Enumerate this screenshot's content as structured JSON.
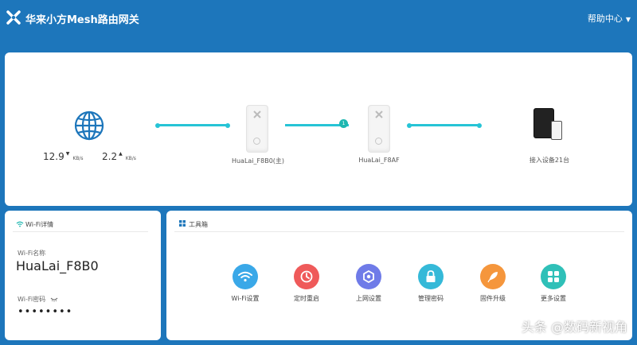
{
  "header": {
    "title": "华来小方Mesh路由网关",
    "help": "帮助中心",
    "help_caret": "▼"
  },
  "topology": {
    "download_speed": "12.9",
    "download_unit": "KB/s",
    "upload_speed": "2.2",
    "upload_unit": "KB/s",
    "main_router": "HuaLai_F8B0(主)",
    "sub_router": "HuaLai_F8AF",
    "mesh_badge": "1",
    "devices": "接入设备21台"
  },
  "wifi": {
    "title": "Wi-Fi详情",
    "name_label": "Wi-Fi名称",
    "name_value": "HuaLai_F8B0",
    "password_label": "Wi-Fi密码",
    "password_value": "••••••••"
  },
  "toolbox": {
    "title": "工具箱",
    "items": [
      {
        "label": "Wi-Fi设置",
        "icon": "wifi-icon",
        "color": "#3aa8e8"
      },
      {
        "label": "定时重启",
        "icon": "clock-icon",
        "color": "#ef5a5a"
      },
      {
        "label": "上网设置",
        "icon": "hexagon-icon",
        "color": "#6f7be8"
      },
      {
        "label": "管理密码",
        "icon": "lock-icon",
        "color": "#35b9d8"
      },
      {
        "label": "固件升级",
        "icon": "rocket-icon",
        "color": "#f5963c"
      },
      {
        "label": "更多设置",
        "icon": "grid-icon",
        "color": "#2fc0b8"
      }
    ]
  },
  "watermark": "头条 @数码新视角",
  "colors": {
    "header_bg": "#1d76bb",
    "link": "#26c4d6"
  }
}
